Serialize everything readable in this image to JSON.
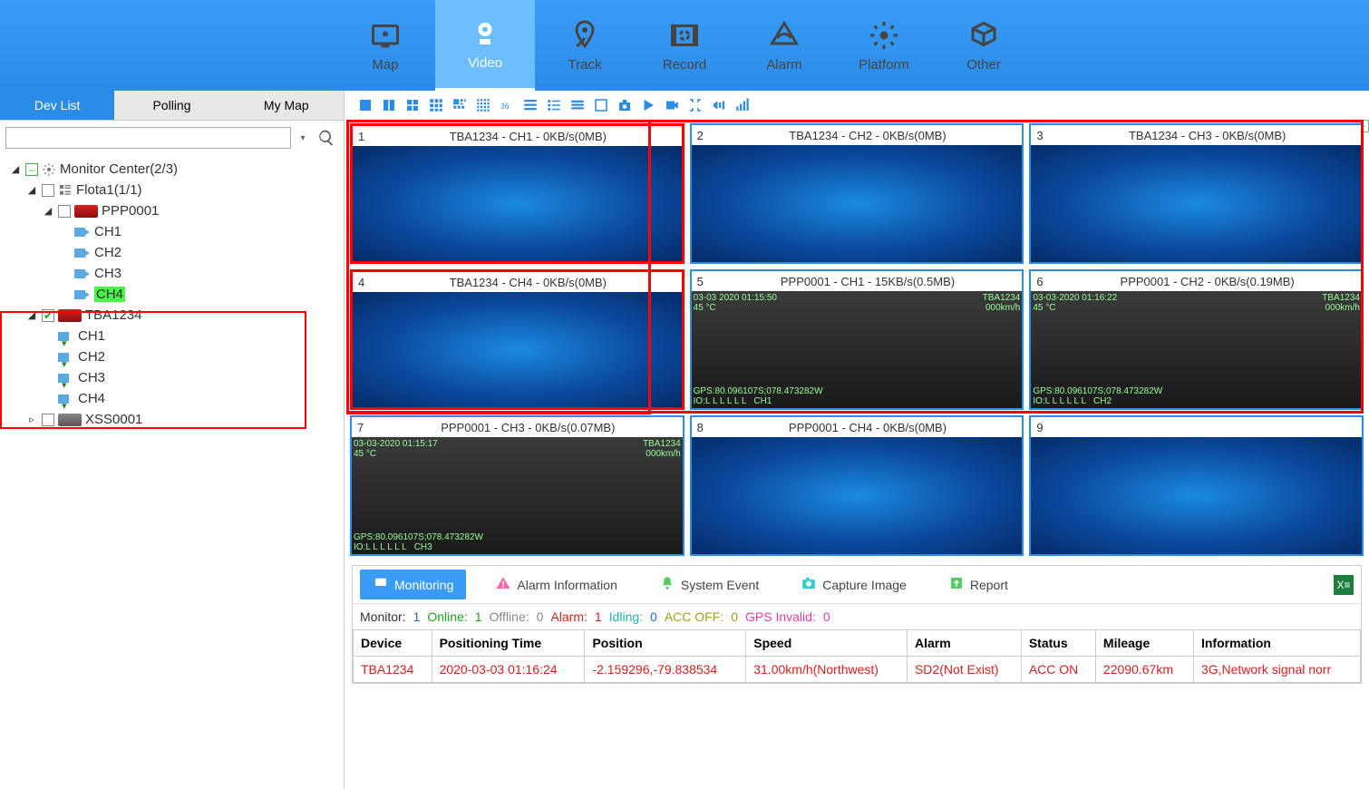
{
  "topnav": [
    {
      "key": "map",
      "label": "Map"
    },
    {
      "key": "video",
      "label": "Video",
      "active": true
    },
    {
      "key": "track",
      "label": "Track"
    },
    {
      "key": "record",
      "label": "Record"
    },
    {
      "key": "alarm",
      "label": "Alarm"
    },
    {
      "key": "platform",
      "label": "Platform"
    },
    {
      "key": "other",
      "label": "Other"
    }
  ],
  "sidebar_tabs": [
    {
      "key": "devlist",
      "label": "Dev List",
      "active": true
    },
    {
      "key": "polling",
      "label": "Polling"
    },
    {
      "key": "mymap",
      "label": "My Map"
    }
  ],
  "search": {
    "value": "",
    "placeholder": ""
  },
  "tree": {
    "root": {
      "label": "Monitor Center(2/3)",
      "children": [
        {
          "label": "Flota1(1/1)",
          "children": [
            {
              "label": "PPP0001",
              "type": "vehicle-red",
              "children": [
                {
                  "label": "CH1",
                  "type": "cam"
                },
                {
                  "label": "CH2",
                  "type": "cam"
                },
                {
                  "label": "CH3",
                  "type": "cam"
                },
                {
                  "label": "CH4",
                  "type": "cam",
                  "hl": true
                }
              ]
            }
          ]
        },
        {
          "label": "TBA1234",
          "type": "vehicle-red",
          "checked": true,
          "children": [
            {
              "label": "CH1",
              "type": "cam-down"
            },
            {
              "label": "CH2",
              "type": "cam-down"
            },
            {
              "label": "CH3",
              "type": "cam-down"
            },
            {
              "label": "CH4",
              "type": "cam-down"
            }
          ]
        },
        {
          "label": "XSS0001",
          "type": "vehicle-gray",
          "collapsed": true
        }
      ]
    }
  },
  "tiles": [
    {
      "n": "1",
      "label": "TBA1234 - CH1 - 0KB/s(0MB)",
      "kind": "blue",
      "selected": true
    },
    {
      "n": "2",
      "label": "TBA1234 - CH2 - 0KB/s(0MB)",
      "kind": "blue"
    },
    {
      "n": "3",
      "label": "TBA1234 - CH3 - 0KB/s(0MB)",
      "kind": "blue"
    },
    {
      "n": "4",
      "label": "TBA1234 - CH4 - 0KB/s(0MB)",
      "kind": "blue",
      "selected": true
    },
    {
      "n": "5",
      "label": "PPP0001 - CH1 - 15KB/s(0.5MB)",
      "kind": "footage",
      "ts": "03-03 2020 01:15:50",
      "dev": "TBA1234",
      "spd": "000km/h",
      "gps": "GPS:80.096107S;078.473282W",
      "ch": "CH1"
    },
    {
      "n": "6",
      "label": "PPP0001 - CH2 - 0KB/s(0.19MB)",
      "kind": "footage",
      "ts": "03-03-2020 01:16:22",
      "dev": "TBA1234",
      "spd": "000km/h",
      "gps": "GPS:80.096107S;078.473282W",
      "ch": "CH2"
    },
    {
      "n": "7",
      "label": "PPP0001 - CH3 - 0KB/s(0.07MB)",
      "kind": "footage",
      "ts": "03-03-2020 01:15:17",
      "dev": "TBA1234",
      "spd": "000km/h",
      "gps": "GPS:80.096107S;078.473282W",
      "ch": "CH3"
    },
    {
      "n": "8",
      "label": "PPP0001 - CH4 - 0KB/s(0MB)",
      "kind": "blue"
    },
    {
      "n": "9",
      "label": "",
      "kind": "blue"
    }
  ],
  "bottom_tabs": [
    {
      "key": "monitoring",
      "label": "Monitoring",
      "active": true,
      "icon": "monitor"
    },
    {
      "key": "alarm",
      "label": "Alarm Information",
      "icon": "warning"
    },
    {
      "key": "sysevent",
      "label": "System Event",
      "icon": "bell"
    },
    {
      "key": "capture",
      "label": "Capture Image",
      "icon": "camera"
    },
    {
      "key": "report",
      "label": "Report",
      "icon": "upload"
    }
  ],
  "stats": {
    "monitor_label": "Monitor:",
    "monitor_val": "1",
    "online_label": "Online:",
    "online_val": "1",
    "offline_label": "Offline:",
    "offline_val": "0",
    "alarm_label": "Alarm:",
    "alarm_val": "1",
    "idling_label": "Idling:",
    "idling_val": "0",
    "accoff_label": "ACC OFF:",
    "accoff_val": "0",
    "gpsinv_label": "GPS Invalid:",
    "gpsinv_val": "0"
  },
  "table": {
    "headers": [
      "Device",
      "Positioning Time",
      "Position",
      "Speed",
      "Alarm",
      "Status",
      "Mileage",
      "Information"
    ],
    "row": {
      "device": "TBA1234",
      "time": "2020-03-03 01:16:24",
      "pos": "-2.159296,-79.838534",
      "speed": "31.00km/h(Northwest)",
      "alarm": "SD2(Not Exist)",
      "status": "ACC ON",
      "mileage": "22090.67km",
      "info": "3G,Network signal norr"
    }
  }
}
